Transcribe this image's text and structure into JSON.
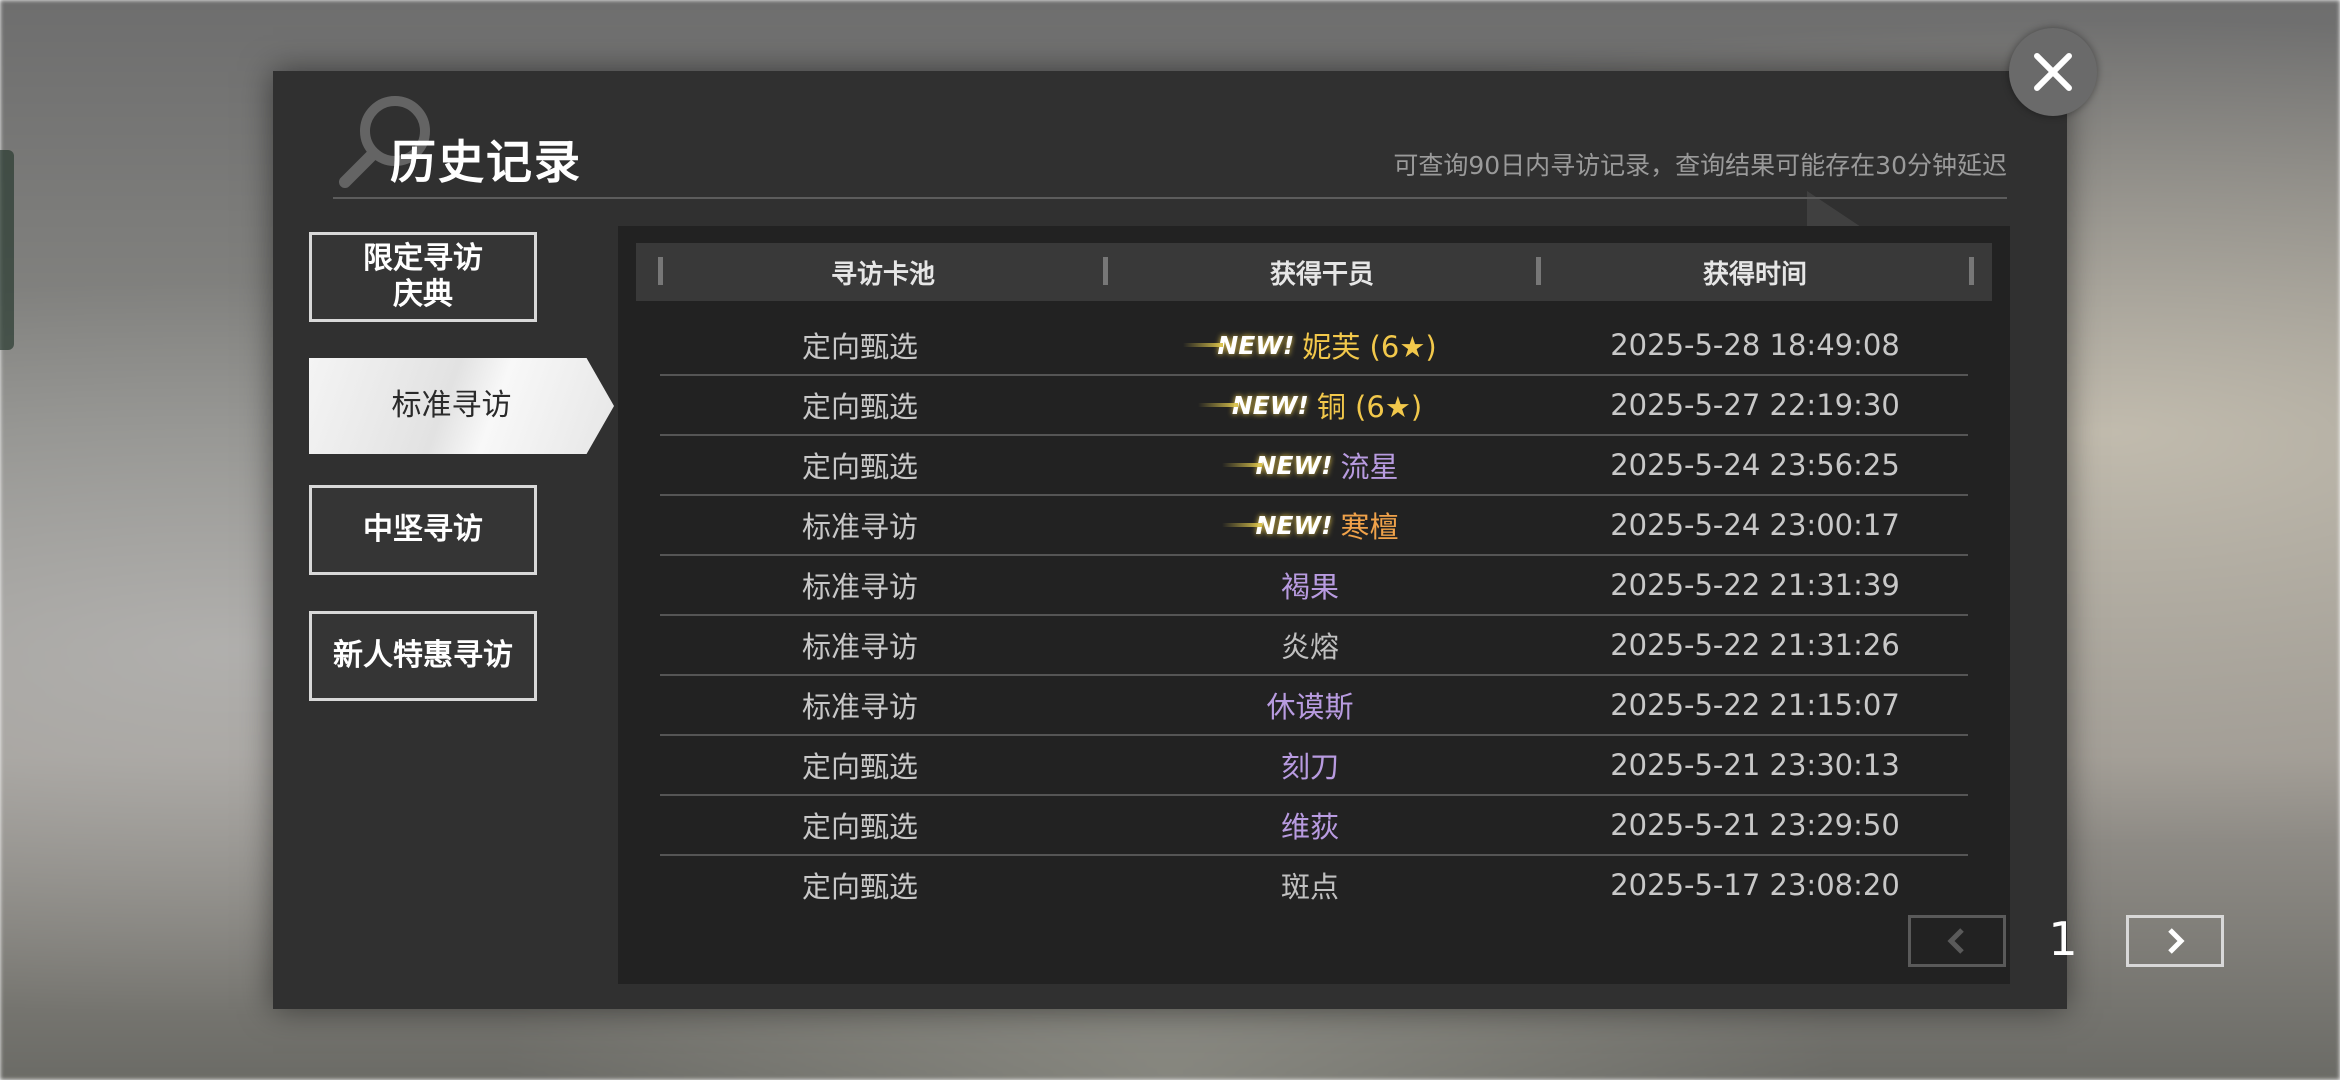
{
  "dialog": {
    "title": "历史记录",
    "subtitle": "可查询90日内寻访记录，查询结果可能存在30分钟延迟"
  },
  "sidebar": {
    "items": [
      {
        "label_line1": "限定寻访",
        "label_line2": "庆典",
        "active": false
      },
      {
        "label": "标准寻访",
        "active": true
      },
      {
        "label": "中坚寻访",
        "active": false
      },
      {
        "label": "新人特惠寻访",
        "active": false
      }
    ]
  },
  "table": {
    "headers": [
      "寻访卡池",
      "获得干员",
      "获得时间"
    ],
    "new_badge": "NEW!",
    "rows": [
      {
        "pool": "定向甄选",
        "operator": "妮芙 (6★)",
        "time": "2025-5-28 18:49:08",
        "new": true,
        "color": "#f2c84b"
      },
      {
        "pool": "定向甄选",
        "operator": "铜 (6★)",
        "time": "2025-5-27 22:19:30",
        "new": true,
        "color": "#f2c84b"
      },
      {
        "pool": "定向甄选",
        "operator": "流星",
        "time": "2025-5-24 23:56:25",
        "new": true,
        "color": "#b89be0"
      },
      {
        "pool": "标准寻访",
        "operator": "寒檀",
        "time": "2025-5-24 23:00:17",
        "new": true,
        "color": "#f0a24a"
      },
      {
        "pool": "标准寻访",
        "operator": "褐果",
        "time": "2025-5-22 21:31:39",
        "new": false,
        "color": "#b89be0"
      },
      {
        "pool": "标准寻访",
        "operator": "炎熔",
        "time": "2025-5-22 21:31:26",
        "new": false,
        "color": "#c0c0c0"
      },
      {
        "pool": "标准寻访",
        "operator": "休谟斯",
        "time": "2025-5-22 21:15:07",
        "new": false,
        "color": "#b89be0"
      },
      {
        "pool": "定向甄选",
        "operator": "刻刀",
        "time": "2025-5-21 23:30:13",
        "new": false,
        "color": "#b89be0"
      },
      {
        "pool": "定向甄选",
        "operator": "维荻",
        "time": "2025-5-21 23:29:50",
        "new": false,
        "color": "#b89be0"
      },
      {
        "pool": "定向甄选",
        "operator": "斑点",
        "time": "2025-5-17 23:08:20",
        "new": false,
        "color": "#c0c0c0"
      }
    ]
  },
  "pager": {
    "page": "1",
    "prev_icon": "chevron-left-icon",
    "next_icon": "chevron-right-icon"
  },
  "close_icon": "close-icon"
}
